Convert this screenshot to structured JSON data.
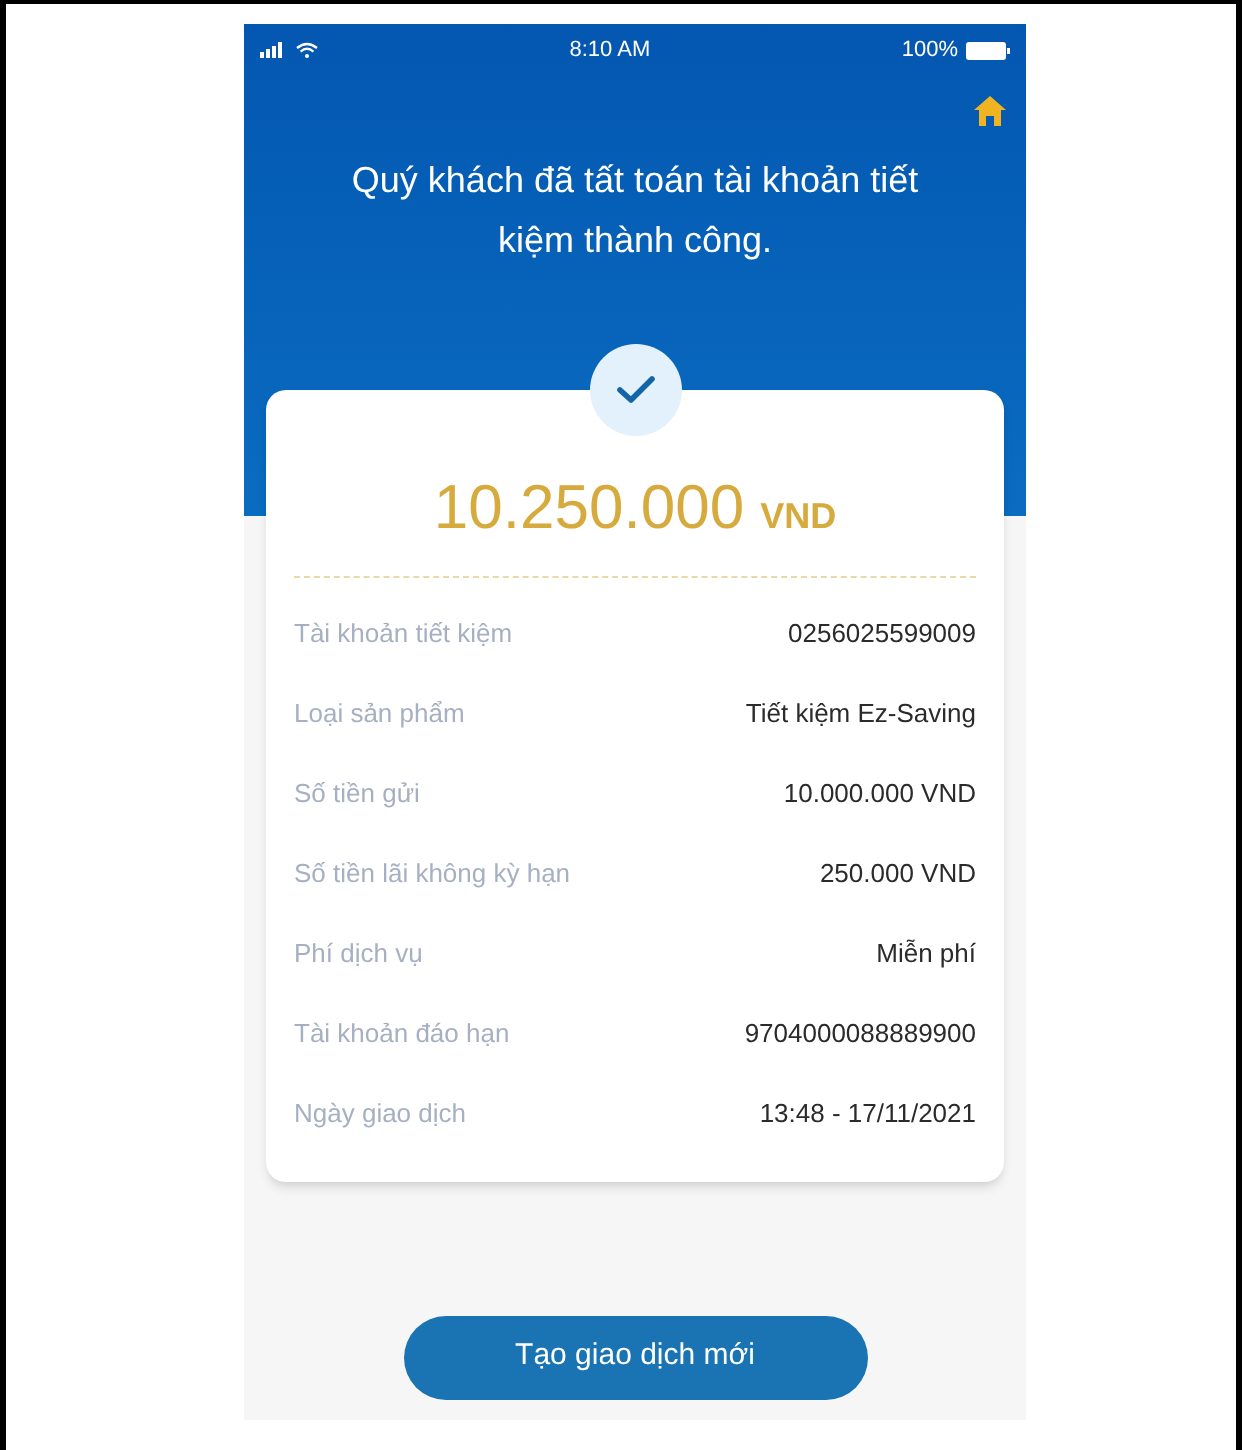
{
  "status_bar": {
    "time": "8:10 AM",
    "battery": "100%"
  },
  "title": "Quý khách đã tất toán tài khoản tiết kiệm thành công.",
  "amount": {
    "value": "10.250.000",
    "currency": "VND"
  },
  "details": [
    {
      "label": "Tài khoản tiết kiệm",
      "value": "0256025599009"
    },
    {
      "label": "Loại sản phẩm",
      "value": "Tiết kiệm Ez-Saving"
    },
    {
      "label": "Số tiền gửi",
      "value": "10.000.000 VND"
    },
    {
      "label": "Số tiền lãi không kỳ hạn",
      "value": "250.000 VND"
    },
    {
      "label": "Phí dịch vụ",
      "value": "Miễn phí"
    },
    {
      "label": "Tài khoản đáo hạn",
      "value": "9704000088889900"
    },
    {
      "label": "Ngày giao dịch",
      "value": "13:48 - 17/11/2021"
    }
  ],
  "button": "Tạo giao dịch mới"
}
